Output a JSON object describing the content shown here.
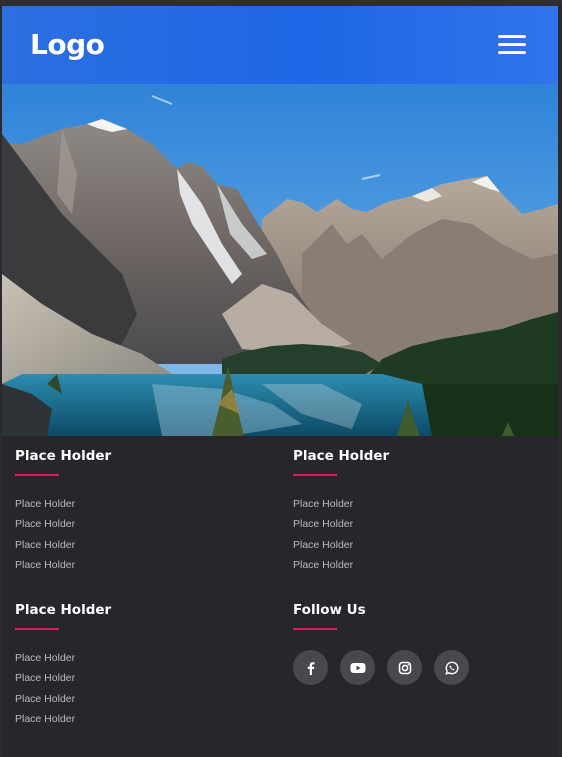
{
  "header": {
    "logo": "Logo",
    "menu_icon": "hamburger-menu-icon",
    "background": "#1e67e6"
  },
  "hero": {
    "image": "mountain-lake-landscape"
  },
  "footer": {
    "accent": "#e0185a",
    "columns": [
      {
        "title": "Place Holder",
        "links": [
          "Place Holder",
          "Place Holder",
          "Place Holder",
          "Place Holder"
        ]
      },
      {
        "title": "Place Holder",
        "links": [
          "Place Holder",
          "Place Holder",
          "Place Holder",
          "Place Holder"
        ]
      },
      {
        "title": "Place Holder",
        "links": [
          "Place Holder",
          "Place Holder",
          "Place Holder",
          "Place Holder"
        ]
      }
    ],
    "follow": {
      "title": "Follow Us",
      "icons": [
        "facebook-icon",
        "youtube-icon",
        "instagram-icon",
        "whatsapp-icon"
      ]
    }
  }
}
